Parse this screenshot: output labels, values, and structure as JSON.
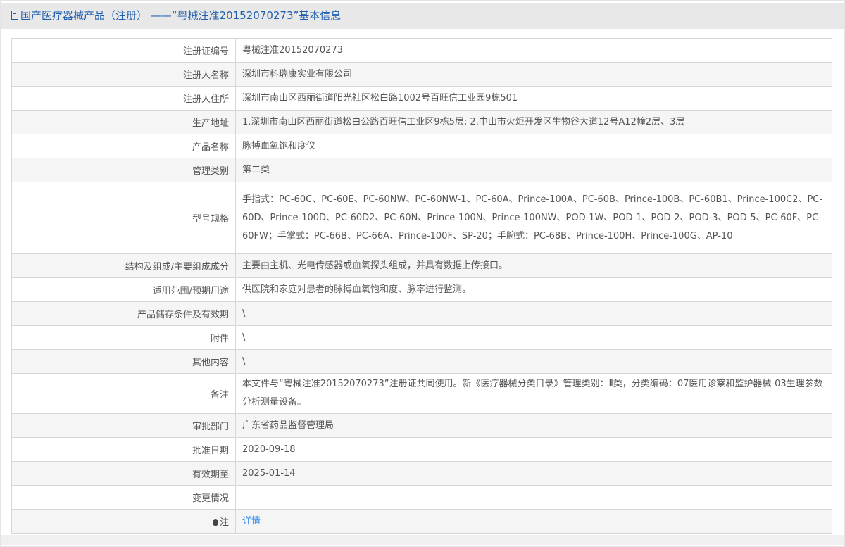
{
  "header": {
    "title": "国产医疗器械产品（注册） ——“粤械注准20152070273”基本信息",
    "icon": "document-icon"
  },
  "rows": [
    {
      "label": "注册证编号",
      "value": "粤械注准20152070273"
    },
    {
      "label": "注册人名称",
      "value": "深圳市科瑞康实业有限公司"
    },
    {
      "label": "注册人住所",
      "value": "深圳市南山区西丽街道阳光社区松白路1002号百旺信工业园9栋501"
    },
    {
      "label": "生产地址",
      "value": "1.深圳市南山区西丽街道松白公路百旺信工业区9栋5层; 2.中山市火炬开发区生物谷大道12号A12幢2层、3层"
    },
    {
      "label": "产品名称",
      "value": "脉搏血氧饱和度仪"
    },
    {
      "label": "管理类别",
      "value": "第二类"
    },
    {
      "label": "型号规格",
      "value": "手指式：PC-60C、PC-60E、PC-60NW、PC-60NW-1、PC-60A、Prince-100A、PC-60B、Prince-100B、PC-60B1、Prince-100C2、PC-60D、Prince-100D、PC-60D2、PC-60N、Prince-100N、Prince-100NW、POD-1W、POD-1、POD-2、POD-3、POD-5、PC-60F、PC-60FW；手掌式：PC-66B、PC-66A、Prince-100F、SP-20；手腕式：PC-68B、Prince-100H、Prince-100G、AP-10"
    },
    {
      "label": "结构及组成/主要组成成分",
      "value": "主要由主机、光电传感器或血氧探头组成，并具有数据上传接口。"
    },
    {
      "label": "适用范围/预期用途",
      "value": "供医院和家庭对患者的脉搏血氧饱和度、脉率进行监测。"
    },
    {
      "label": "产品储存条件及有效期",
      "value": "\\"
    },
    {
      "label": "附件",
      "value": "\\"
    },
    {
      "label": "其他内容",
      "value": "\\"
    },
    {
      "label": "备注",
      "value": "本文件与“粤械注准20152070273”注册证共同使用。新《医疗器械分类目录》管理类别：Ⅱ类，分类编码：07医用诊察和监护器械-03生理参数分析测量设备。"
    },
    {
      "label": "审批部门",
      "value": "广东省药品监督管理局"
    },
    {
      "label": "批准日期",
      "value": "2020-09-18"
    },
    {
      "label": "有效期至",
      "value": "2025-01-14"
    },
    {
      "label": "变更情况",
      "value": ""
    }
  ],
  "note": {
    "label": "注",
    "link": "详情",
    "icon": "lightbulb-icon"
  }
}
